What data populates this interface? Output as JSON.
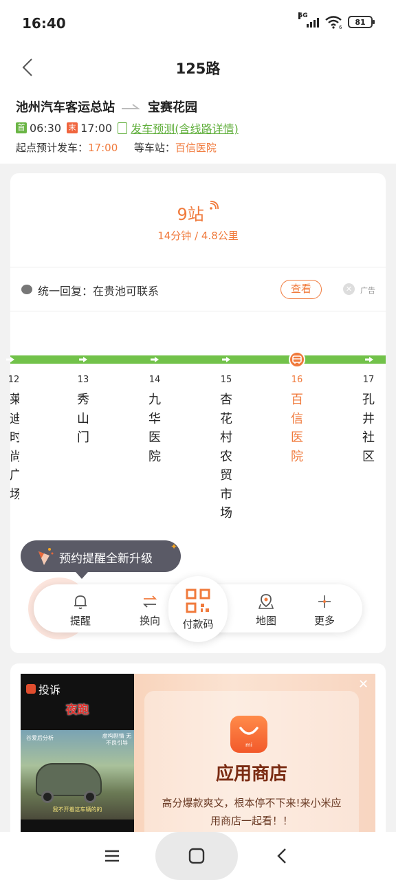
{
  "status_bar": {
    "time": "16:40",
    "network": "5G",
    "wifi_badge": "6",
    "battery": "81"
  },
  "header": {
    "title": "125路",
    "from": "池州汽车客运总站",
    "to": "宝赛花园",
    "first_tag": "首",
    "first_time": "06:30",
    "last_tag": "末",
    "last_time": "17:00",
    "forecast_link": "发车预测(含线路详情)",
    "depart_label": "起点预计发车：",
    "depart_time": "17:00",
    "wait_label": "等车站：",
    "wait_station": "百信医院"
  },
  "eta": {
    "stations": "9站",
    "detail": "14分钟 / 4.8公里"
  },
  "ad": {
    "text": "统一回复：在贵池可联系",
    "button": "查看",
    "label": "广告"
  },
  "stops": [
    {
      "num": "12",
      "name": "莱迪时尚广场",
      "current": false
    },
    {
      "num": "13",
      "name": "秀山门",
      "current": false
    },
    {
      "num": "14",
      "name": "九华医院",
      "current": false
    },
    {
      "num": "15",
      "name": "杏花村农贸市场",
      "current": false
    },
    {
      "num": "16",
      "name": "百信医院",
      "current": true
    },
    {
      "num": "17",
      "name": "孔井社区",
      "current": false
    }
  ],
  "tooltip": "预约提醒全新升级",
  "toolbar": {
    "remind": "提醒",
    "switch": "换向",
    "pay_code": "付款码",
    "map": "地图",
    "more": "更多"
  },
  "promo": {
    "video_complain": "投诉",
    "video_title": "夜跑",
    "video_cap_left": "谷爱后分析",
    "video_cap_right": "虚构剧情 无不良引导",
    "video_subtitle": "我不开着这车辆的的",
    "app_title": "应用商店",
    "app_desc": "高分爆款爽文，根本停不下来!来小米应用商店一起看！！",
    "icon_letters": "mi"
  },
  "colors": {
    "accent": "#f07a3c",
    "line_green": "#72c24a",
    "first_green": "#6ab545"
  }
}
